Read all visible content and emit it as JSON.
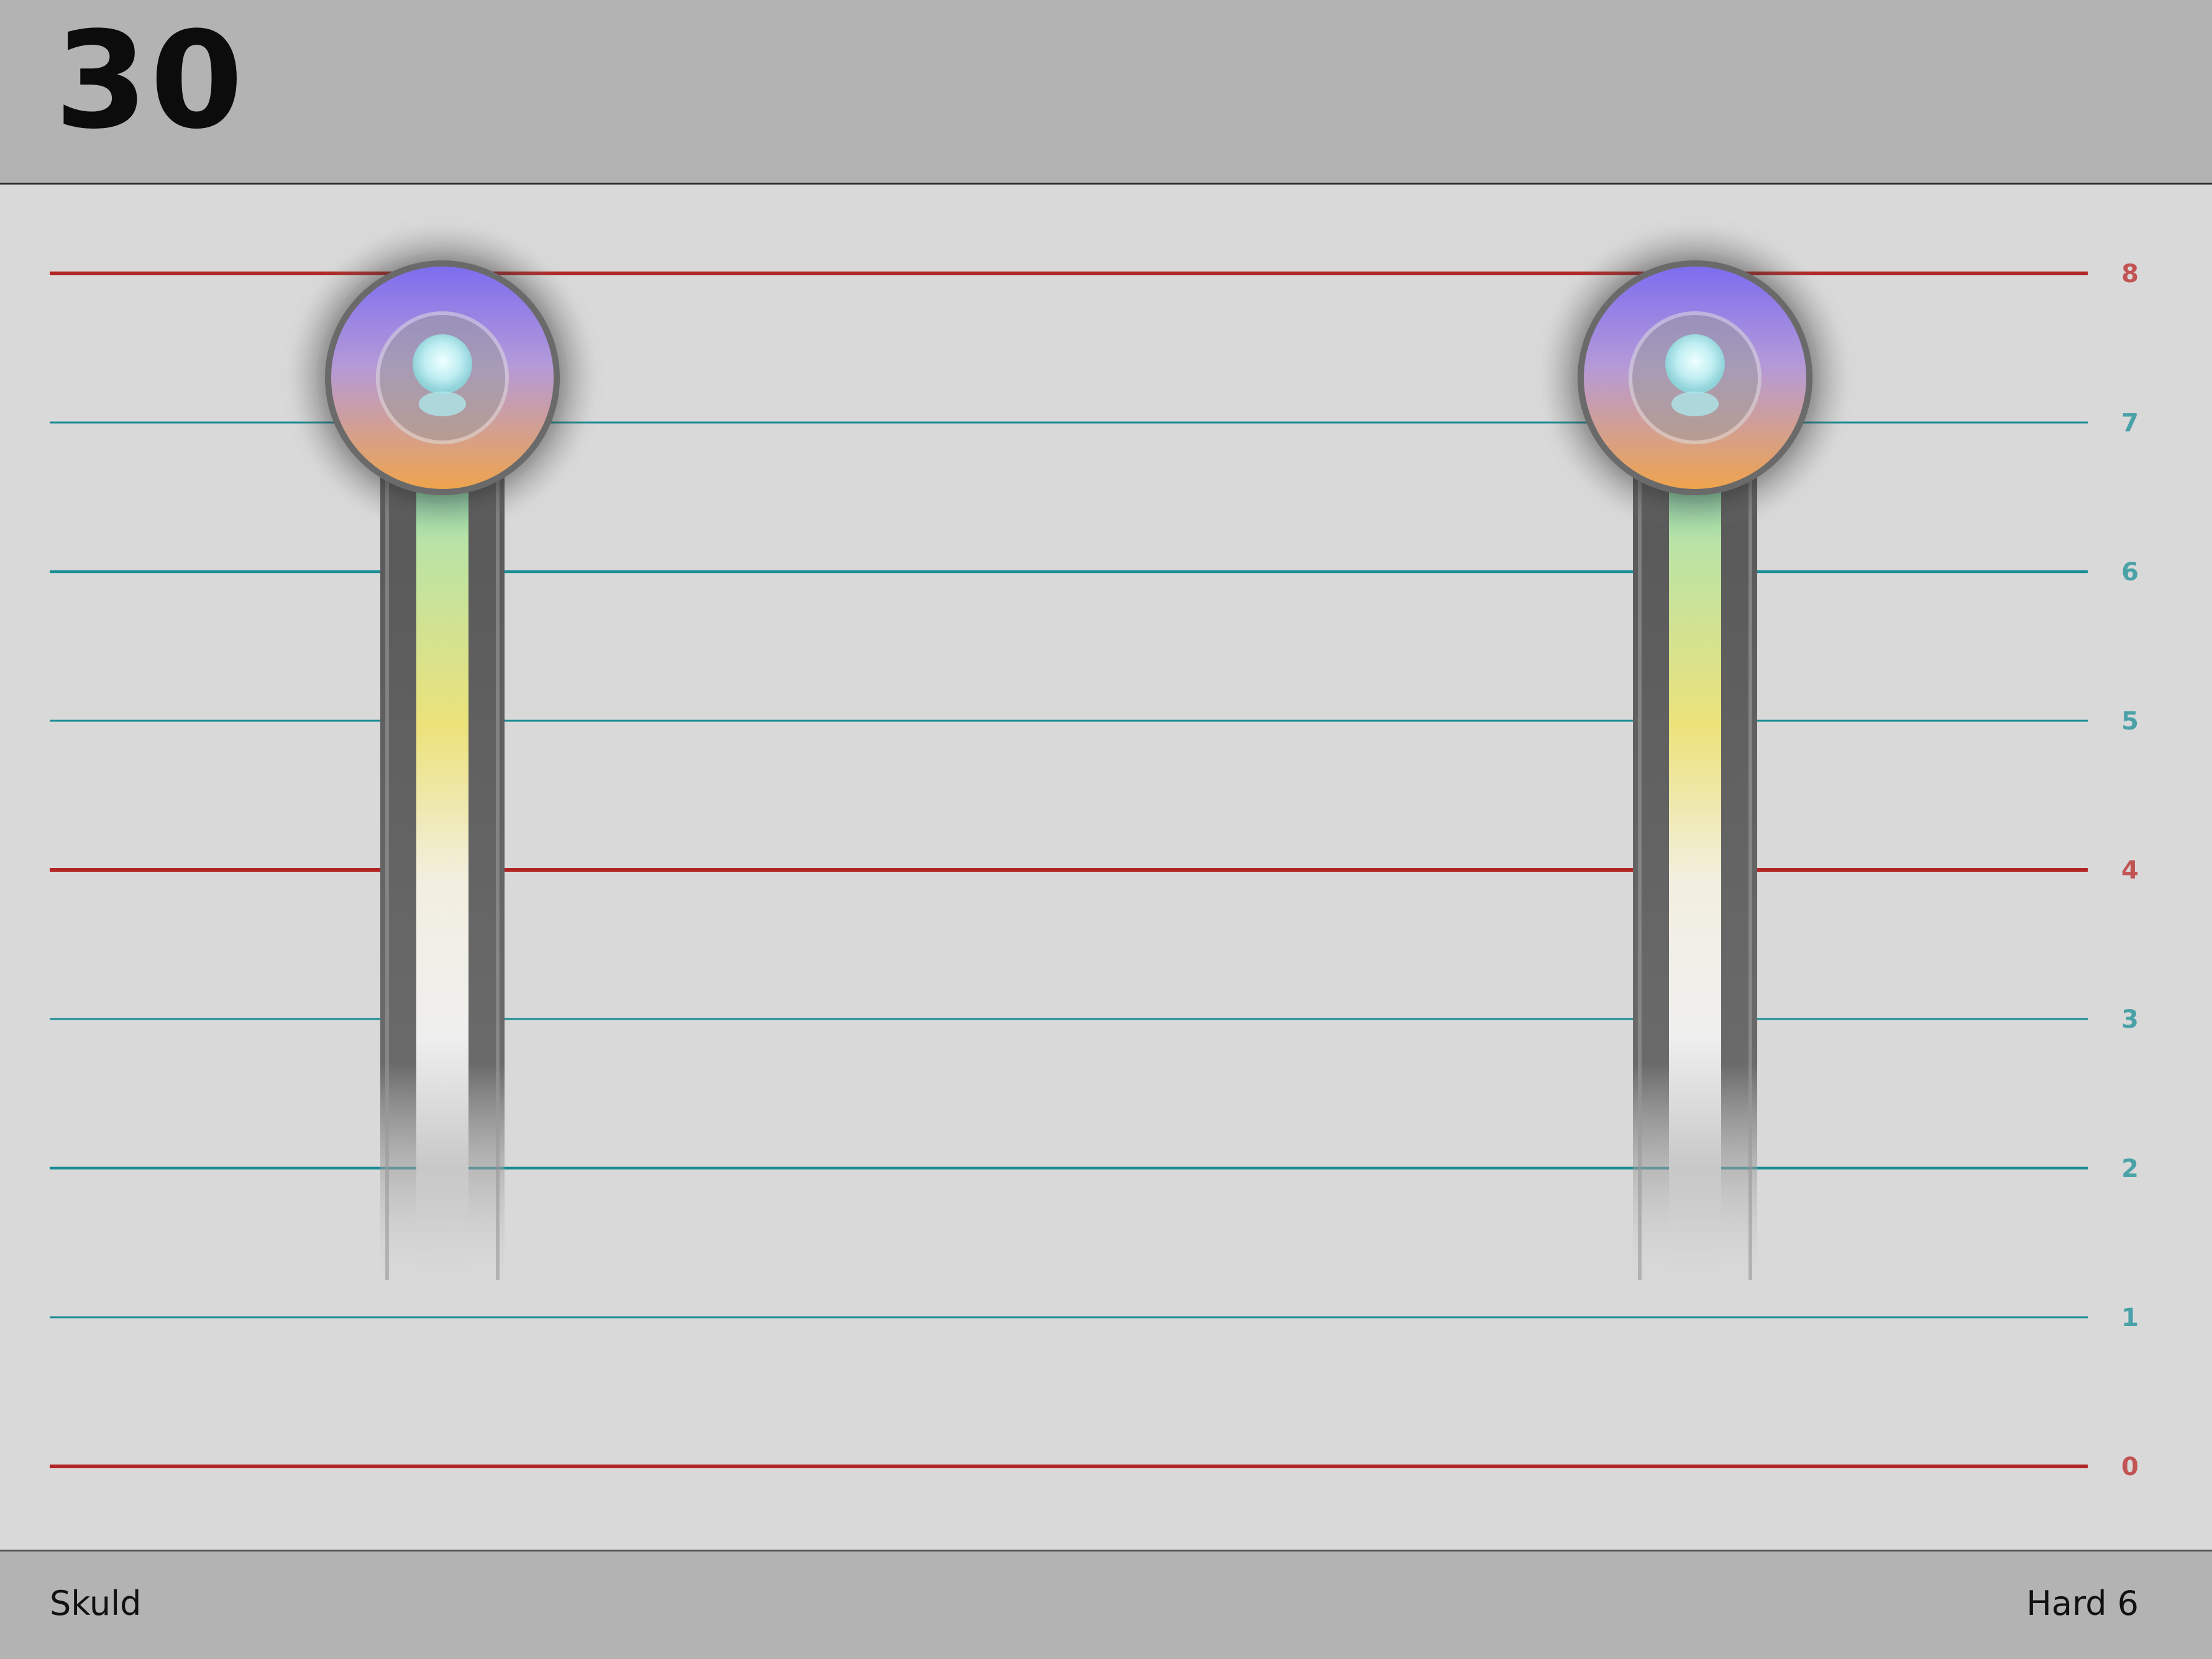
{
  "header": {
    "score": "30"
  },
  "staff": {
    "levels": [
      {
        "label": "0",
        "kind": "major"
      },
      {
        "label": "1",
        "kind": "minor"
      },
      {
        "label": "2",
        "kind": "minor-strong"
      },
      {
        "label": "3",
        "kind": "minor"
      },
      {
        "label": "4",
        "kind": "major"
      },
      {
        "label": "5",
        "kind": "minor"
      },
      {
        "label": "6",
        "kind": "minor-strong"
      },
      {
        "label": "7",
        "kind": "minor"
      },
      {
        "label": "8",
        "kind": "major"
      }
    ],
    "colors": {
      "major": "#b22626",
      "minor": "#1a8c94",
      "major_label": "#c25454",
      "minor_label": "#4aa2a8"
    }
  },
  "players": [
    {
      "name": "left-pitch-meter",
      "level": 7.3,
      "icon": "pitch-orb-icon"
    },
    {
      "name": "right-pitch-meter",
      "level": 7.3,
      "icon": "pitch-orb-icon"
    }
  ],
  "footer": {
    "song": "Skuld",
    "difficulty": "Hard 6"
  }
}
